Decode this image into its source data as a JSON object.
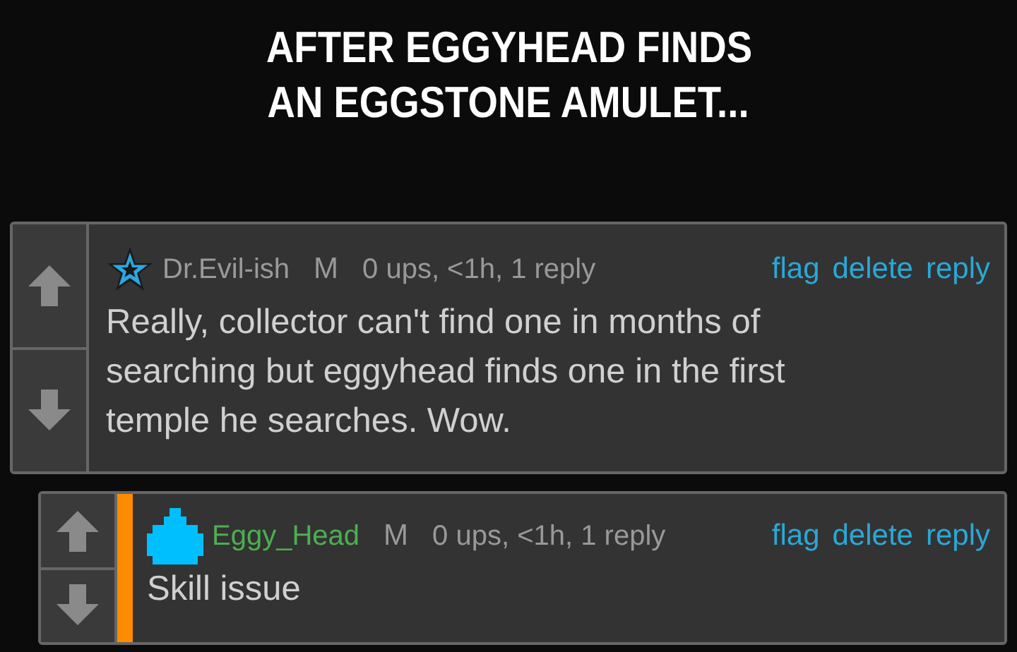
{
  "caption": {
    "lines": [
      "AFTER EGGYHEAD FINDS",
      "AN EGGSTONE AMULET..."
    ]
  },
  "comments": [
    {
      "kind": "star",
      "username": "Dr.Evil-ish",
      "color": "#9a9a9a",
      "badge": "M",
      "meta": "0 ups, <1h, 1 reply",
      "actions": [
        "flag",
        "delete",
        "reply"
      ],
      "body": [
        "Really, collector can't find one in months of",
        "searching but eggyhead finds one in the first",
        "temple he searches. Wow."
      ],
      "children": [
        {
          "kind": "blob",
          "username": "Eggy_Head",
          "color": "#4caf50",
          "badge": "M",
          "meta": "0 ups, <1h, 1 reply",
          "actions": [
            "flag",
            "delete",
            "reply"
          ],
          "body": [
            "Skill issue"
          ]
        }
      ]
    }
  ]
}
